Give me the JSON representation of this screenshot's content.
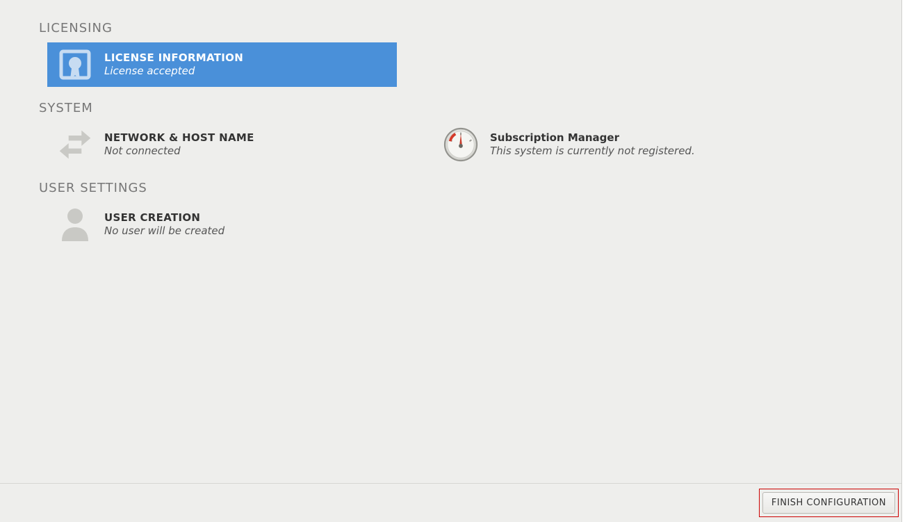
{
  "sections": {
    "licensing": {
      "heading": "LICENSING",
      "license_info": {
        "title": "LICENSE INFORMATION",
        "status": "License accepted"
      }
    },
    "system": {
      "heading": "SYSTEM",
      "network": {
        "title": "NETWORK & HOST NAME",
        "status": "Not connected"
      },
      "subscription": {
        "title": "Subscription Manager",
        "status": "This system is currently not registered."
      }
    },
    "user_settings": {
      "heading": "USER SETTINGS",
      "user_creation": {
        "title": "USER CREATION",
        "status": "No user will be created"
      }
    }
  },
  "footer": {
    "finish_label": "FINISH CONFIGURATION"
  },
  "colors": {
    "accent": "#4a90d9",
    "highlight_border": "#cc0000"
  }
}
